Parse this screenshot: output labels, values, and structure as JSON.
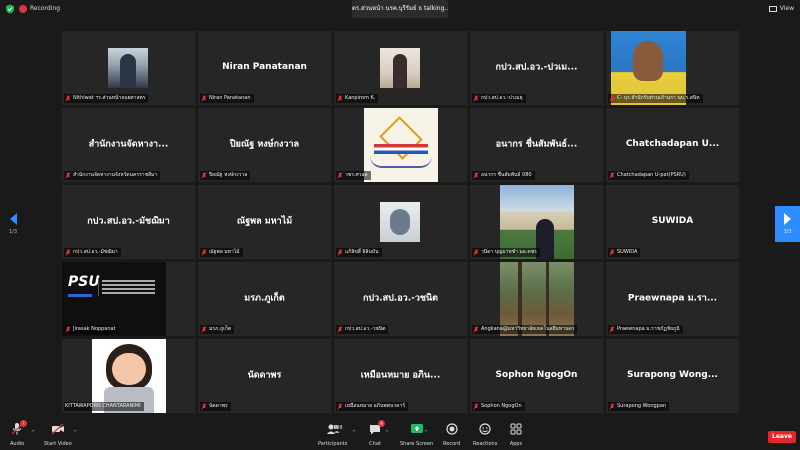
{
  "topbar": {
    "recording_label": "Recording",
    "talking_label": "ดร.ส่วนหน้า นรค.บุรีรัมย์ ธ  talking...",
    "view_label": "View"
  },
  "tiles": [
    {
      "name": "",
      "label": "Nithiwat ฯร.ส่วนหน้าจนยศาสตร"
    },
    {
      "name": "Niran Panatanan",
      "label": "Niran Panatanan"
    },
    {
      "name": "",
      "label": "Kanpirom K."
    },
    {
      "name": "กปว.สป.อว.-ปวเม...",
      "label": "กปว.สป.อว.-ปวเมธุ"
    },
    {
      "name": "",
      "label": "C- บุร.สำนักรับท่านเภ้านรา นบ.ร.สนิท"
    },
    {
      "name": "สำนักงานจัดหางา...",
      "label": "สำนักงานจัดหางานจังหวัดนครราชสีมา"
    },
    {
      "name": "ปิยณัฐ หงษ์กงวาล",
      "label": "ปิยณัฐ หงษ์กงวาล"
    },
    {
      "name": "",
      "label": "วชร.ศวอล"
    },
    {
      "name": "อนากร ชื่นสัมพันธ์...",
      "label": "อนากร ชื่นสัมพันธ์ 080"
    },
    {
      "name": "Chatchadapan U...",
      "label": "Chatchadapan U-pat(PSRU)"
    },
    {
      "name": "กปว.สป.อว.-มัชฌิมา",
      "label": "กปว.สป.อว.-มัชฌิมา"
    },
    {
      "name": "ณัฐพล มหาไม้",
      "label": "ณัฐพล มหาไม้"
    },
    {
      "name": "",
      "label": "แก้ลิขสิ์ ลิลินบัน"
    },
    {
      "name": "",
      "label": "วนิดา บุญมาหชำ มอ.คชร"
    },
    {
      "name": "SUWIDA",
      "label": "SUWIDA"
    },
    {
      "name": "",
      "label": "Jirasak Noppanat"
    },
    {
      "name": "มรภ.ภูเก็ต",
      "label": "มรภ.ภูเก็ต"
    },
    {
      "name": "กปว.สป.อว.-วชนิต",
      "label": "กปว.สป.อว.-วชนิต"
    },
    {
      "name": "",
      "label": "Angkana@มหาวิทยาลัยเทคโนลยีมหานคร"
    },
    {
      "name": "Praewnapa ม.รา...",
      "label": "Praewnapa ม.ราชภัฏชัยภูมิ"
    },
    {
      "name": "",
      "label": "KITTAWAPORN CHANTARANIMI"
    },
    {
      "name": "นัดดาพร",
      "label": "นัดดาพร"
    },
    {
      "name": "เหมือนหมาย อภิน...",
      "label": "เหมือนหมาย อภินพพนาคาร์"
    },
    {
      "name": "Sophon NgogOn",
      "label": "Sophon NgogOn"
    },
    {
      "name": "Surapong  Wong...",
      "label": "Surapong Wongpan"
    }
  ],
  "paging": {
    "left": "1/3",
    "right": "3/3"
  },
  "toolbar": {
    "audio": "Audio",
    "start_video": "Start Video",
    "participants": "Participants",
    "participants_count": "198",
    "chat": "Chat",
    "chat_badge": "9",
    "share_screen": "Share Screen",
    "record": "Record",
    "reactions": "Reactions",
    "apps": "Apps",
    "leave": "Leave"
  },
  "colors": {
    "accent": "#2d8cff",
    "leave": "#e02828",
    "share": "#1fbd5f",
    "tile_bg": "#262626",
    "bg": "#1a1a1a"
  }
}
